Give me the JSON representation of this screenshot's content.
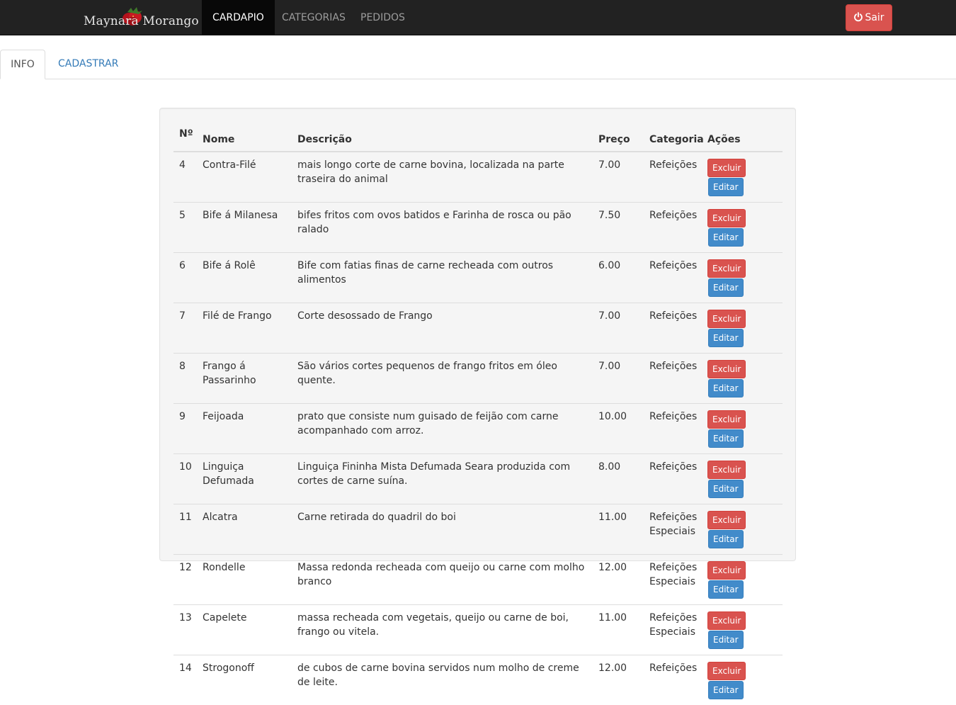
{
  "brand": {
    "name": "Maynara Morango"
  },
  "nav": {
    "items": [
      {
        "label": "CARDAPIO",
        "active": true
      },
      {
        "label": "CATEGORIAS",
        "active": false
      },
      {
        "label": "PEDIDOS",
        "active": false
      }
    ],
    "logout_label": "Sair",
    "logout_icon": "power-icon"
  },
  "tabs": [
    {
      "label": "INFO",
      "active": true
    },
    {
      "label": "CADASTRAR",
      "active": false
    }
  ],
  "table": {
    "headers": [
      "Nº",
      "Nome",
      "Descrição",
      "Preço",
      "Categoria",
      "Ações"
    ],
    "delete_label": "Excluir",
    "edit_label": "Editar",
    "rows": [
      {
        "id": "4",
        "nome": "Contra-Filé",
        "descricao": "mais longo corte de carne bovina, localizada na parte traseira do animal",
        "preco": "7.00",
        "categoria": "Refeições"
      },
      {
        "id": "5",
        "nome": "Bife á Milanesa",
        "descricao": "bifes fritos com ovos batidos e Farinha de rosca ou pão ralado",
        "preco": "7.50",
        "categoria": "Refeições"
      },
      {
        "id": "6",
        "nome": "Bife á Rolê",
        "descricao": "Bife com fatias finas de carne recheada com outros alimentos",
        "preco": "6.00",
        "categoria": "Refeições"
      },
      {
        "id": "7",
        "nome": "Filé de Frango",
        "descricao": "Corte desossado de Frango",
        "preco": "7.00",
        "categoria": "Refeições"
      },
      {
        "id": "8",
        "nome": "Frango á Passarinho",
        "descricao": "São vários cortes pequenos de frango fritos em óleo quente.",
        "preco": "7.00",
        "categoria": "Refeições"
      },
      {
        "id": "9",
        "nome": "Feijoada",
        "descricao": "prato que consiste num guisado de feijão com carne acompanhado com arroz.",
        "preco": "10.00",
        "categoria": "Refeições"
      },
      {
        "id": "10",
        "nome": "Linguiça Defumada",
        "descricao": "Linguiça Fininha Mista Defumada Seara produzida com cortes de carne suína.",
        "preco": "8.00",
        "categoria": "Refeições"
      },
      {
        "id": "11",
        "nome": "Alcatra",
        "descricao": "Carne retirada do quadril do boi",
        "preco": "11.00",
        "categoria": "Refeições Especiais"
      },
      {
        "id": "12",
        "nome": "Rondelle",
        "descricao": "Massa redonda recheada com queijo ou carne com molho branco",
        "preco": "12.00",
        "categoria": "Refeições Especiais"
      },
      {
        "id": "13",
        "nome": "Capelete",
        "descricao": "massa recheada com vegetais, queijo ou carne de boi, frango ou vitela.",
        "preco": "11.00",
        "categoria": "Refeições Especiais"
      },
      {
        "id": "14",
        "nome": "Strogonoff",
        "descricao": "de cubos de carne bovina servidos num molho de creme de leite.",
        "preco": "12.00",
        "categoria": "Refeições"
      }
    ]
  },
  "colors": {
    "navbar_bg": "#222222",
    "danger": "#d9534f",
    "primary": "#428bca",
    "link": "#337ab7"
  }
}
